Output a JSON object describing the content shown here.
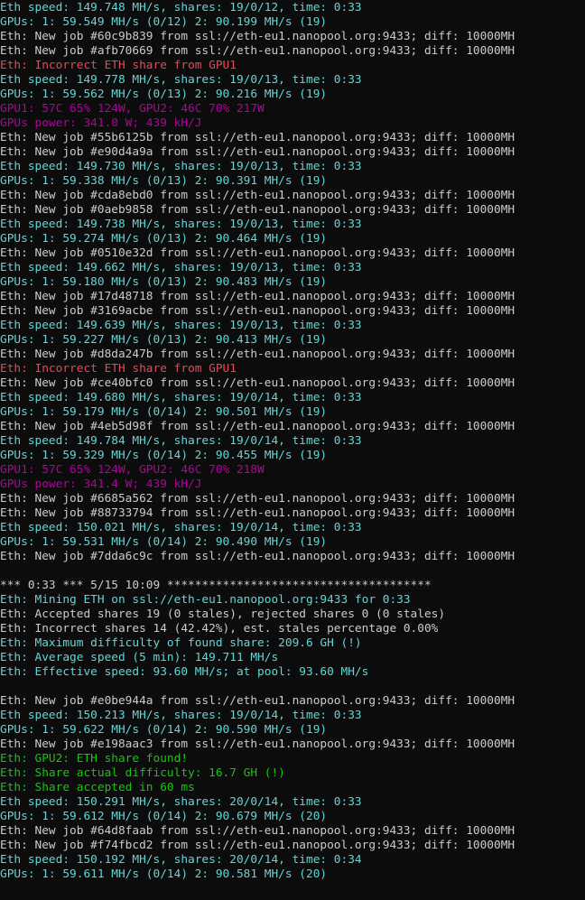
{
  "colors": {
    "background": "#0c0c0c",
    "cyan": "#61d6d6",
    "gray": "#cccccc",
    "red": "#e74856",
    "magenta": "#b4009e",
    "green": "#16c60c"
  },
  "lines": [
    {
      "text": "Eth speed: 149.748 MH/s, shares: 19/0/12, time: 0:33",
      "color": "cyan"
    },
    {
      "text": "GPUs: 1: 59.549 MH/s (0/12) 2: 90.199 MH/s (19)",
      "color": "cyan"
    },
    {
      "text": "Eth: New job #60c9b839 from ssl://eth-eu1.nanopool.org:9433; diff: 10000MH",
      "color": "gray"
    },
    {
      "text": "Eth: New job #afb70669 from ssl://eth-eu1.nanopool.org:9433; diff: 10000MH",
      "color": "gray"
    },
    {
      "text": "Eth: Incorrect ETH share from GPU1",
      "color": "red"
    },
    {
      "text": "Eth speed: 149.778 MH/s, shares: 19/0/13, time: 0:33",
      "color": "cyan"
    },
    {
      "text": "GPUs: 1: 59.562 MH/s (0/13) 2: 90.216 MH/s (19)",
      "color": "cyan"
    },
    {
      "text": "GPU1: 57C 65% 124W, GPU2: 46C 70% 217W",
      "color": "magenta"
    },
    {
      "text": "GPUs power: 341.0 W; 439 kH/J",
      "color": "magenta"
    },
    {
      "text": "Eth: New job #55b6125b from ssl://eth-eu1.nanopool.org:9433; diff: 10000MH",
      "color": "gray"
    },
    {
      "text": "Eth: New job #e90d4a9a from ssl://eth-eu1.nanopool.org:9433; diff: 10000MH",
      "color": "gray"
    },
    {
      "text": "Eth speed: 149.730 MH/s, shares: 19/0/13, time: 0:33",
      "color": "cyan"
    },
    {
      "text": "GPUs: 1: 59.338 MH/s (0/13) 2: 90.391 MH/s (19)",
      "color": "cyan"
    },
    {
      "text": "Eth: New job #cda8ebd0 from ssl://eth-eu1.nanopool.org:9433; diff: 10000MH",
      "color": "gray"
    },
    {
      "text": "Eth: New job #0aeb9858 from ssl://eth-eu1.nanopool.org:9433; diff: 10000MH",
      "color": "gray"
    },
    {
      "text": "Eth speed: 149.738 MH/s, shares: 19/0/13, time: 0:33",
      "color": "cyan"
    },
    {
      "text": "GPUs: 1: 59.274 MH/s (0/13) 2: 90.464 MH/s (19)",
      "color": "cyan"
    },
    {
      "text": "Eth: New job #0510e32d from ssl://eth-eu1.nanopool.org:9433; diff: 10000MH",
      "color": "gray"
    },
    {
      "text": "Eth speed: 149.662 MH/s, shares: 19/0/13, time: 0:33",
      "color": "cyan"
    },
    {
      "text": "GPUs: 1: 59.180 MH/s (0/13) 2: 90.483 MH/s (19)",
      "color": "cyan"
    },
    {
      "text": "Eth: New job #17d48718 from ssl://eth-eu1.nanopool.org:9433; diff: 10000MH",
      "color": "gray"
    },
    {
      "text": "Eth: New job #3169acbe from ssl://eth-eu1.nanopool.org:9433; diff: 10000MH",
      "color": "gray"
    },
    {
      "text": "Eth speed: 149.639 MH/s, shares: 19/0/13, time: 0:33",
      "color": "cyan"
    },
    {
      "text": "GPUs: 1: 59.227 MH/s (0/13) 2: 90.413 MH/s (19)",
      "color": "cyan"
    },
    {
      "text": "Eth: New job #d8da247b from ssl://eth-eu1.nanopool.org:9433; diff: 10000MH",
      "color": "gray"
    },
    {
      "text": "Eth: Incorrect ETH share from GPU1",
      "color": "red"
    },
    {
      "text": "Eth: New job #ce40bfc0 from ssl://eth-eu1.nanopool.org:9433; diff: 10000MH",
      "color": "gray"
    },
    {
      "text": "Eth speed: 149.680 MH/s, shares: 19/0/14, time: 0:33",
      "color": "cyan"
    },
    {
      "text": "GPUs: 1: 59.179 MH/s (0/14) 2: 90.501 MH/s (19)",
      "color": "cyan"
    },
    {
      "text": "Eth: New job #4eb5d98f from ssl://eth-eu1.nanopool.org:9433; diff: 10000MH",
      "color": "gray"
    },
    {
      "text": "Eth speed: 149.784 MH/s, shares: 19/0/14, time: 0:33",
      "color": "cyan"
    },
    {
      "text": "GPUs: 1: 59.329 MH/s (0/14) 2: 90.455 MH/s (19)",
      "color": "cyan"
    },
    {
      "text": "GPU1: 57C 65% 124W, GPU2: 46C 70% 218W",
      "color": "magenta"
    },
    {
      "text": "GPUs power: 341.4 W; 439 kH/J",
      "color": "magenta"
    },
    {
      "text": "Eth: New job #6685a562 from ssl://eth-eu1.nanopool.org:9433; diff: 10000MH",
      "color": "gray"
    },
    {
      "text": "Eth: New job #88733794 from ssl://eth-eu1.nanopool.org:9433; diff: 10000MH",
      "color": "gray"
    },
    {
      "text": "Eth speed: 150.021 MH/s, shares: 19/0/14, time: 0:33",
      "color": "cyan"
    },
    {
      "text": "GPUs: 1: 59.531 MH/s (0/14) 2: 90.490 MH/s (19)",
      "color": "cyan"
    },
    {
      "text": "Eth: New job #7dda6c9c from ssl://eth-eu1.nanopool.org:9433; diff: 10000MH",
      "color": "gray"
    },
    {
      "text": "",
      "color": "gray"
    },
    {
      "text": "*** 0:33 *** 5/15 10:09 **************************************",
      "color": "gray"
    },
    {
      "text": "Eth: Mining ETH on ssl://eth-eu1.nanopool.org:9433 for 0:33",
      "color": "cyan"
    },
    {
      "text": "Eth: Accepted shares 19 (0 stales), rejected shares 0 (0 stales)",
      "color": "gray"
    },
    {
      "text": "Eth: Incorrect shares 14 (42.42%), est. stales percentage 0.00%",
      "color": "gray"
    },
    {
      "text": "Eth: Maximum difficulty of found share: 209.6 GH (!)",
      "color": "cyan"
    },
    {
      "text": "Eth: Average speed (5 min): 149.711 MH/s",
      "color": "cyan"
    },
    {
      "text": "Eth: Effective speed: 93.60 MH/s; at pool: 93.60 MH/s",
      "color": "cyan"
    },
    {
      "text": "",
      "color": "gray"
    },
    {
      "text": "Eth: New job #e0be944a from ssl://eth-eu1.nanopool.org:9433; diff: 10000MH",
      "color": "gray"
    },
    {
      "text": "Eth speed: 150.213 MH/s, shares: 19/0/14, time: 0:33",
      "color": "cyan"
    },
    {
      "text": "GPUs: 1: 59.622 MH/s (0/14) 2: 90.590 MH/s (19)",
      "color": "cyan"
    },
    {
      "text": "Eth: New job #e198aac3 from ssl://eth-eu1.nanopool.org:9433; diff: 10000MH",
      "color": "gray"
    },
    {
      "text": "Eth: GPU2: ETH share found!",
      "color": "green"
    },
    {
      "text": "Eth: Share actual difficulty: 16.7 GH (!)",
      "color": "green"
    },
    {
      "text": "Eth: Share accepted in 60 ms",
      "color": "green"
    },
    {
      "text": "Eth speed: 150.291 MH/s, shares: 20/0/14, time: 0:33",
      "color": "cyan"
    },
    {
      "text": "GPUs: 1: 59.612 MH/s (0/14) 2: 90.679 MH/s (20)",
      "color": "cyan"
    },
    {
      "text": "Eth: New job #64d8faab from ssl://eth-eu1.nanopool.org:9433; diff: 10000MH",
      "color": "gray"
    },
    {
      "text": "Eth: New job #f74fbcd2 from ssl://eth-eu1.nanopool.org:9433; diff: 10000MH",
      "color": "gray"
    },
    {
      "text": "Eth speed: 150.192 MH/s, shares: 20/0/14, time: 0:34",
      "color": "cyan"
    },
    {
      "text": "GPUs: 1: 59.611 MH/s (0/14) 2: 90.581 MH/s (20)",
      "color": "cyan"
    }
  ]
}
